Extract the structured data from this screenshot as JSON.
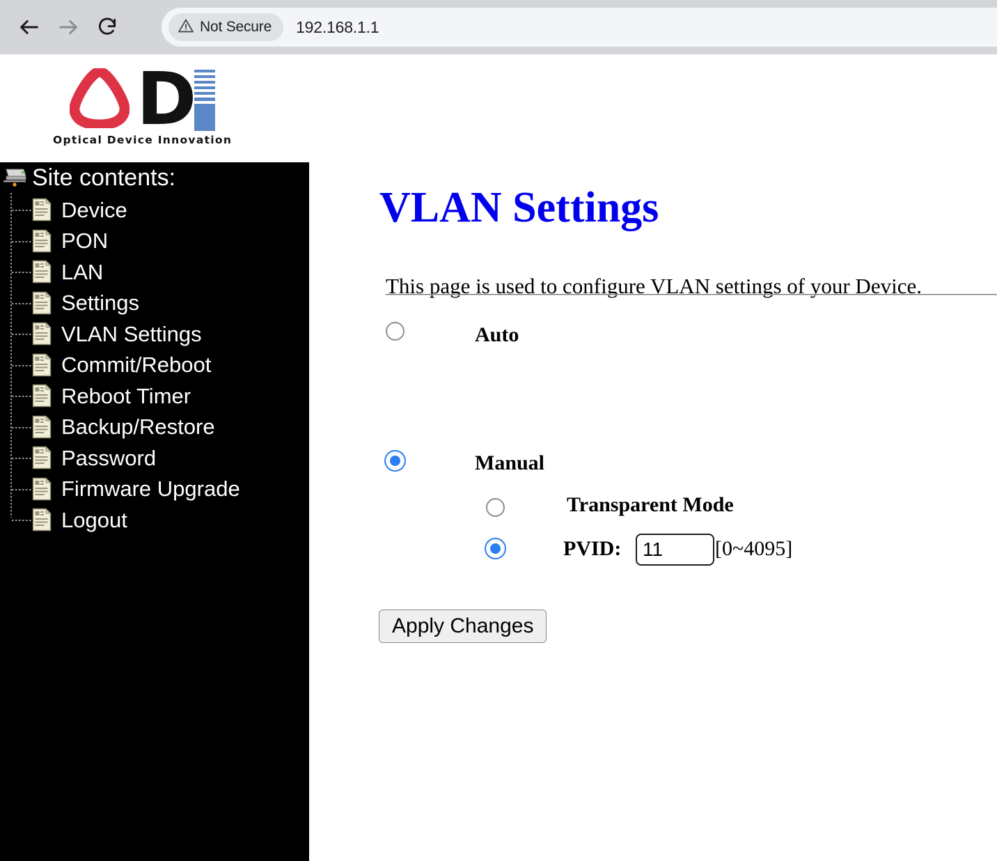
{
  "browser": {
    "back_icon": "arrow-left-icon",
    "forward_icon": "arrow-right-icon",
    "reload_icon": "reload-icon",
    "security_warning_icon": "warning-triangle-icon",
    "security_label": "Not Secure",
    "url": "192.168.1.1"
  },
  "logo": {
    "letter_d": "D",
    "tagline": "Optical Device Innovation",
    "colors": {
      "o_red": "#dd3344",
      "d_black": "#121212",
      "i_blue": "#5b87c7"
    }
  },
  "sidebar": {
    "root_label": "Site contents:",
    "root_icon": "computer-icon",
    "items": [
      {
        "label": "Device",
        "icon": "document-icon"
      },
      {
        "label": "PON",
        "icon": "document-icon"
      },
      {
        "label": "LAN",
        "icon": "document-icon"
      },
      {
        "label": "Settings",
        "icon": "document-icon"
      },
      {
        "label": "VLAN Settings",
        "icon": "document-icon"
      },
      {
        "label": "Commit/Reboot",
        "icon": "document-icon"
      },
      {
        "label": "Reboot Timer",
        "icon": "document-icon"
      },
      {
        "label": "Backup/Restore",
        "icon": "document-icon"
      },
      {
        "label": "Password",
        "icon": "document-icon"
      },
      {
        "label": "Firmware Upgrade",
        "icon": "document-icon"
      },
      {
        "label": "Logout",
        "icon": "document-icon"
      }
    ]
  },
  "main": {
    "title": "VLAN Settings",
    "title_color": "#0000ee",
    "description": "This page is used to configure VLAN settings of your Device.",
    "options": {
      "auto_label": "Auto",
      "auto_checked": false,
      "manual_label": "Manual",
      "manual_checked": true,
      "transparent_label": "Transparent Mode",
      "transparent_checked": false,
      "pvid_label": "PVID:",
      "pvid_checked": true,
      "pvid_value": "11",
      "pvid_range_hint": "[0~4095]"
    },
    "apply_label": "Apply Changes"
  }
}
